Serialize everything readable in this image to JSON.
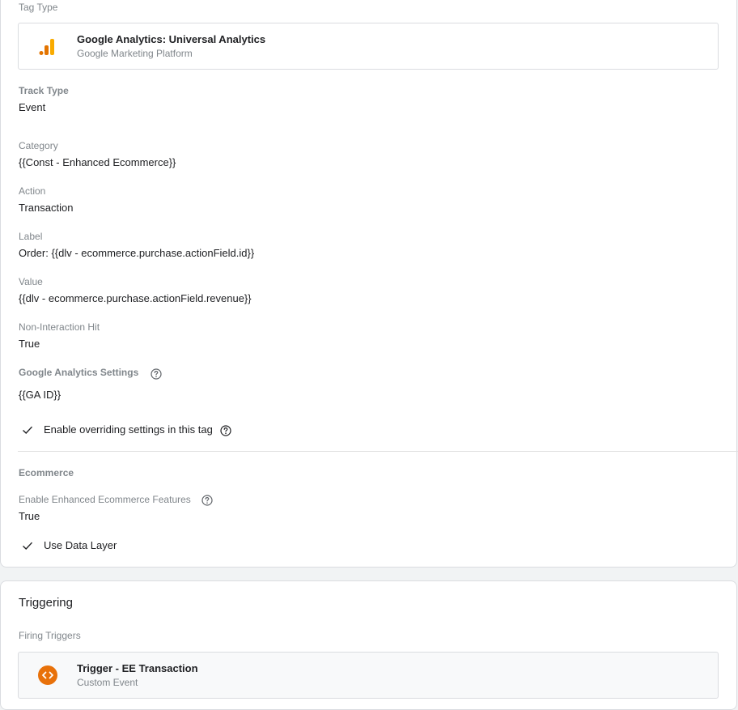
{
  "tag_config": {
    "tag_type_label": "Tag Type",
    "tag_type": {
      "title": "Google Analytics: Universal Analytics",
      "subtitle": "Google Marketing Platform",
      "icon": "google-analytics-icon",
      "icon_color": "#f9ab00"
    },
    "fields": [
      {
        "label": "Track Type",
        "value": "Event"
      },
      {
        "label": "Category",
        "value": "{{Const - Enhanced Ecommerce}}"
      },
      {
        "label": "Action",
        "value": "Transaction"
      },
      {
        "label": "Label",
        "value": "Order: {{dlv - ecommerce.purchase.actionField.id}}"
      },
      {
        "label": "Value",
        "value": "{{dlv - ecommerce.purchase.actionField.revenue}}"
      },
      {
        "label": "Non-Interaction Hit",
        "value": "True"
      }
    ],
    "ga_settings": {
      "label": "Google Analytics Settings",
      "value": "{{GA ID}}",
      "override_label": "Enable overriding settings in this tag"
    },
    "ecommerce": {
      "heading": "Ecommerce",
      "enhanced_label": "Enable Enhanced Ecommerce Features",
      "enhanced_value": "True",
      "data_layer_label": "Use Data Layer"
    }
  },
  "triggering": {
    "heading": "Triggering",
    "firing_label": "Firing Triggers",
    "trigger": {
      "title": "Trigger - EE Transaction",
      "subtitle": "Custom Event",
      "icon": "custom-event-icon",
      "icon_color": "#e8710a"
    }
  }
}
